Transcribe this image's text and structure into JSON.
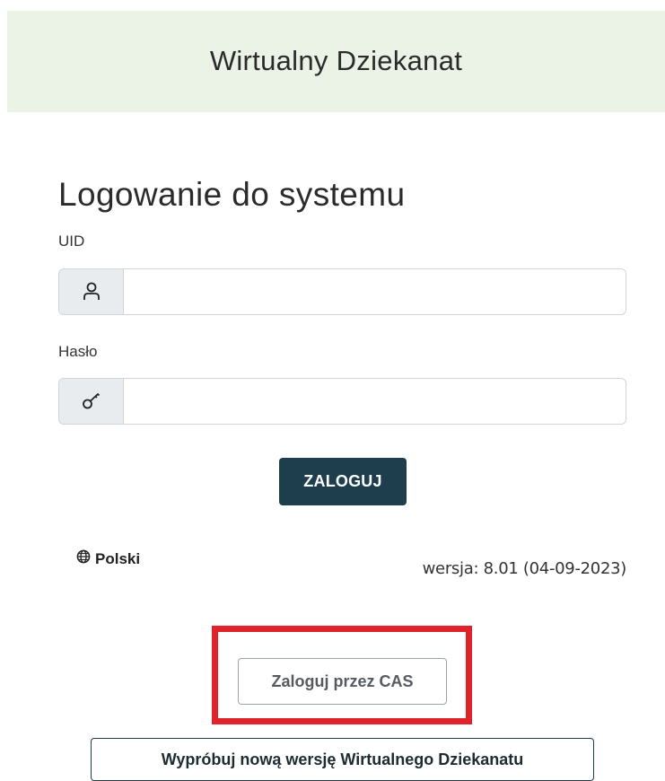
{
  "header": {
    "title": "Wirtualny Dziekanat"
  },
  "login": {
    "heading": "Logowanie do systemu",
    "uid_label": "UID",
    "uid_value": "",
    "uid_icon": "user-icon",
    "password_label": "Hasło",
    "password_value": "",
    "password_icon": "key-icon",
    "submit_label": "ZALOGUJ"
  },
  "footer": {
    "language_icon": "globe-icon",
    "language_label": "Polski",
    "version_text": "wersja: 8.01 (04-09-2023)"
  },
  "alternatives": {
    "cas_button_label": "Zaloguj przez CAS",
    "new_version_button_label": "Wypróbuj nową wersję Wirtualnego Dziekanatu"
  },
  "colors": {
    "header_bg": "#ebf3e6",
    "primary_button": "#1f3e4d",
    "highlight": "#e0222b"
  }
}
